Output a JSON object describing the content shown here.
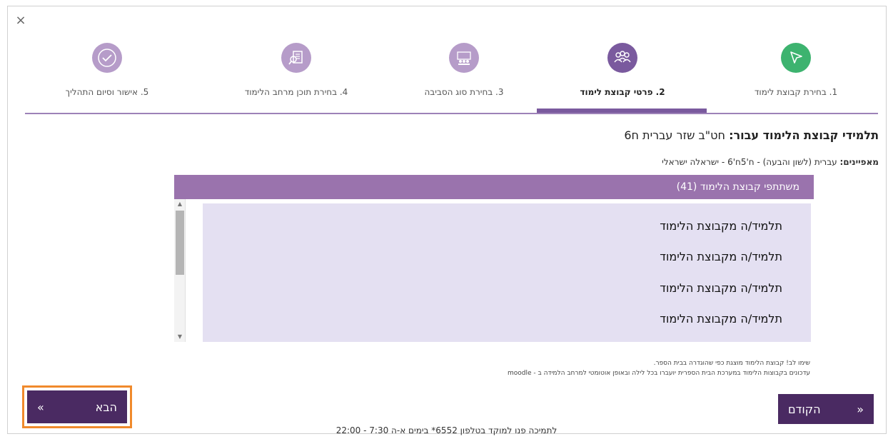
{
  "dialog": {
    "close_glyph": "×"
  },
  "colors": {
    "accent": "#7a5a9e",
    "panel_header": "#9a73ad",
    "list_bg": "#e4e0f2",
    "button_bg": "#4a2a62",
    "highlight_border": "#f08a2c",
    "step1_circle": "#3db36f",
    "step_inactive_circle": "#b69cc9",
    "step_active_circle": "#7a5a9e"
  },
  "steps": [
    {
      "label": "1. בחירת קבוצת לימוד",
      "icon": "cursor-arrow-icon",
      "active": false
    },
    {
      "label": "2. פרטי קבוצת לימוד",
      "icon": "group-people-icon",
      "active": true
    },
    {
      "label": "3. בחירת סוג הסביבה",
      "icon": "classroom-icon",
      "active": false
    },
    {
      "label": "4. בחירת תוכן מרחב הלימוד",
      "icon": "content-search-icon",
      "active": false
    },
    {
      "label": "5. אישור וסיום התהליך",
      "icon": "checkmark-icon",
      "active": false
    }
  ],
  "title": {
    "prefix": "תלמידי קבוצת הלימוד עבור:",
    "group_name": "חט\"ב שזר עברית ח6"
  },
  "characteristics": {
    "label": "מאפיינים:",
    "value": "עברית (לשון והבעה) - ח'5ח'6 - ישראלה ישראלי"
  },
  "participants": {
    "header": "משתתפי קבוצת הלימוד (41)",
    "items": [
      "תלמיד/ה מקבוצת הלימוד",
      "תלמיד/ה מקבוצת הלימוד",
      "תלמיד/ה מקבוצת הלימוד",
      "תלמיד/ה מקבוצת הלימוד"
    ]
  },
  "notes": [
    "שימו לב! קבוצת הלימוד מוצגת כפי שהוגדרה בבית הספר.",
    "עדכונים בקבוצות הלימוד במערכת הבית הספרית יועברו בכל לילה ובאופן אוטומטי למרחב הלמידה ב - moodle"
  ],
  "buttons": {
    "next_label": "הבא",
    "next_glyph": "«",
    "prev_label": "הקודם",
    "prev_glyph": "»"
  },
  "footer": "לתמיכה פנו למוקד בטלפון 6552* בימים א-ה 7:30 - 22:00"
}
